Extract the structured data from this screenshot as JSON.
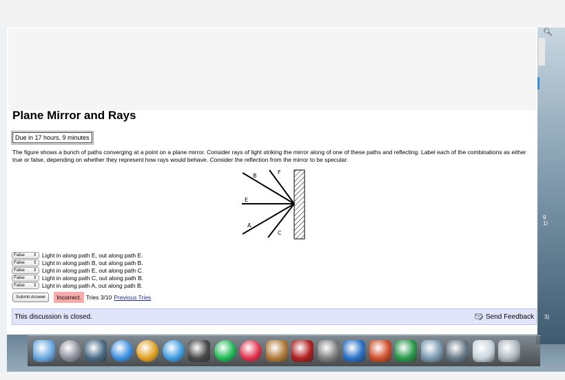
{
  "question": {
    "title": "Plane Mirror and Rays",
    "due": "Due in 17 hours, 9 minutes",
    "prompt": "The figure shows a bunch of paths converging at a point on a plane mirror. Consider rays of light striking the mirror along of one of these paths and reflecting. Label each of the combinations as either true or false, depending on whether they represent how rays would behave. Consider the reflection from the mirror to be specular."
  },
  "figure": {
    "labels": {
      "b": "B",
      "f": "F",
      "e": "E",
      "a": "A",
      "c": "C"
    }
  },
  "answers": [
    {
      "value": "False",
      "text": "Light in along path E, out along path E."
    },
    {
      "value": "False",
      "text": "Light in along path B, out along path B."
    },
    {
      "value": "False",
      "text": "Light in along path E, out along path C."
    },
    {
      "value": "False",
      "text": "Light in along path C, out along path B."
    },
    {
      "value": "False",
      "text": "Light in along path A, out along path B."
    }
  ],
  "submission": {
    "submit_label": "Submit Answer",
    "status": "Incorrect.",
    "tries": "Tries 3/10",
    "previous_tries": "Previous Tries"
  },
  "discussion": {
    "text": "This discussion is closed.",
    "feedback_label": "Send Feedback"
  },
  "side_labels": {
    "s1": "g",
    "s2": "1)",
    "s3": "3)"
  },
  "select_arrow": "⇕",
  "dock": [
    {
      "name": "finder-icon",
      "color": "#6aa8e0"
    },
    {
      "name": "launchpad-icon",
      "color": "#8a8f9a"
    },
    {
      "name": "mission-control-icon",
      "color": "#4a6b85"
    },
    {
      "name": "app-store-icon",
      "color": "#3b8fe0"
    },
    {
      "name": "chrome-icon",
      "color": "#e0a020"
    },
    {
      "name": "safari-icon",
      "color": "#3c9be0"
    },
    {
      "name": "facetime-icon",
      "color": "#4a4a4a"
    },
    {
      "name": "spotify-icon",
      "color": "#1db954"
    },
    {
      "name": "itunes-icon",
      "color": "#e0304a"
    },
    {
      "name": "iphoto-icon",
      "color": "#b07a3a"
    },
    {
      "name": "photo-booth-icon",
      "color": "#b02020"
    },
    {
      "name": "system-preferences-icon",
      "color": "#808080"
    },
    {
      "name": "word-icon",
      "color": "#2b72c8"
    },
    {
      "name": "powerpoint-icon",
      "color": "#d0502a"
    },
    {
      "name": "excel-icon",
      "color": "#2a9a4a"
    },
    {
      "name": "network-utility-icon",
      "color": "#7a9ab0"
    },
    {
      "name": "preview-icon",
      "color": "#6a7a8a"
    },
    {
      "name": "documents-folder-icon",
      "color": "#c7d4dc"
    },
    {
      "name": "trash-icon",
      "color": "#b0b8c0"
    }
  ]
}
